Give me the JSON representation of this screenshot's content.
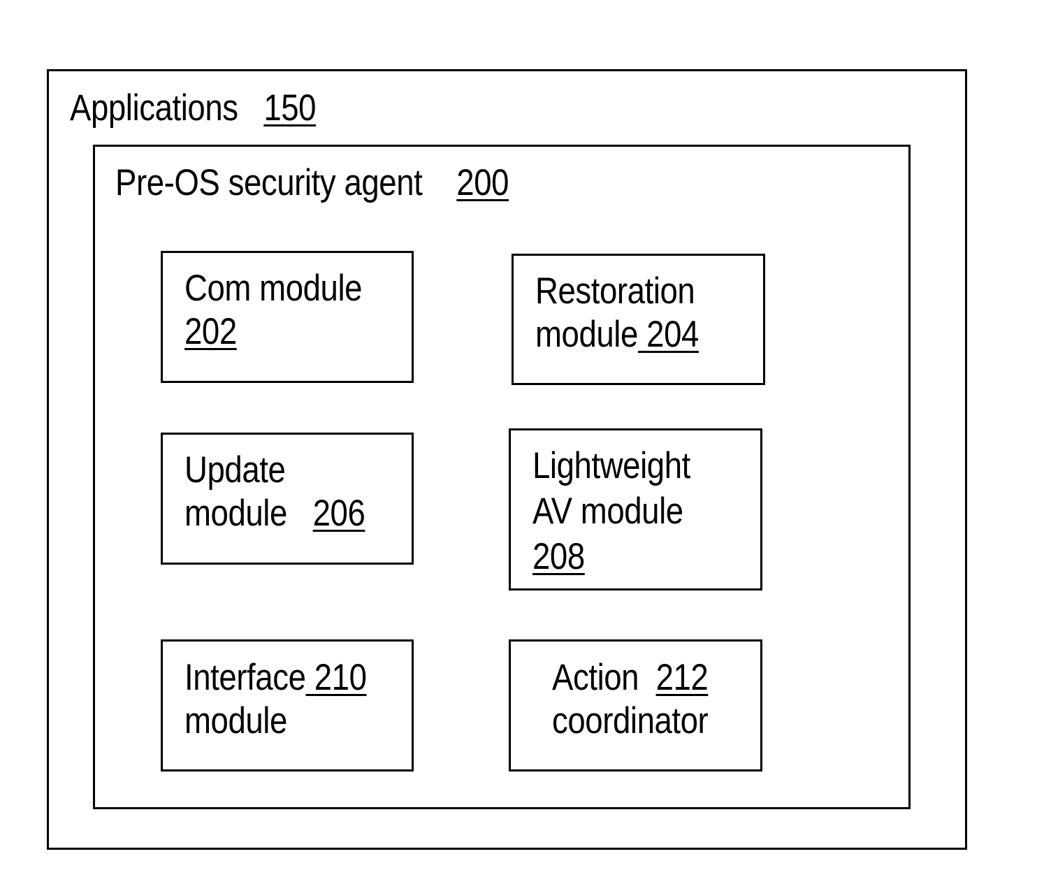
{
  "outer": {
    "label": "Applications",
    "ref": "150"
  },
  "agent": {
    "label": "Pre-OS security agent",
    "ref": "200"
  },
  "modules": [
    {
      "line1": "Com module",
      "line2": "",
      "ref": "202"
    },
    {
      "line1": "Restoration",
      "line2": "module",
      "ref": "204"
    },
    {
      "line1": "Update",
      "line2": "module",
      "ref": "206"
    },
    {
      "line1": "Lightweight",
      "line2": "AV module",
      "ref": "208"
    },
    {
      "line1": "Interface",
      "line2": "module",
      "ref": "210"
    },
    {
      "line1": "Action",
      "line2": "coordinator",
      "ref": "212"
    }
  ]
}
